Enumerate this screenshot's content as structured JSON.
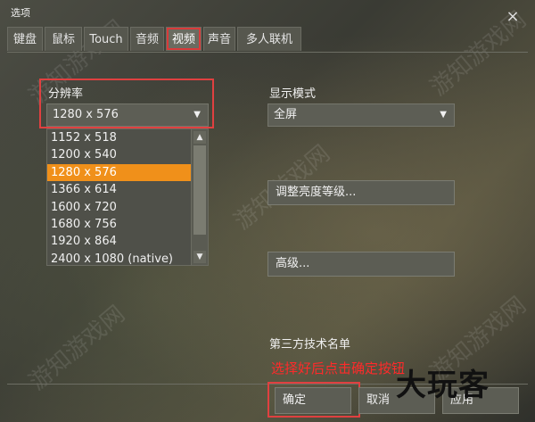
{
  "window": {
    "title": "选项",
    "close_icon": "×"
  },
  "tabs": [
    {
      "label": "键盘",
      "active": false
    },
    {
      "label": "鼠标",
      "active": false
    },
    {
      "label": "Touch",
      "active": false
    },
    {
      "label": "音频",
      "active": false
    },
    {
      "label": "视频",
      "active": true
    },
    {
      "label": "声音",
      "active": false
    },
    {
      "label": "多人联机",
      "active": false
    }
  ],
  "resolution": {
    "label": "分辨率",
    "selected": "1280 x 576",
    "options": [
      "1152 x 518",
      "1200 x 540",
      "1280 x 576",
      "1366 x 614",
      "1600 x 720",
      "1680 x 756",
      "1920 x 864",
      "2400 x 1080 (native)"
    ],
    "selected_index": 2
  },
  "display_mode": {
    "label": "显示模式",
    "selected": "全屏"
  },
  "buttons": {
    "brightness": "调整亮度等级...",
    "advanced": "高级...",
    "ok": "确定",
    "cancel": "取消",
    "apply": "应用"
  },
  "third_party_label": "第三方技术名单",
  "hint_text": "选择好后点击确定按钮",
  "brand_text": "大玩客",
  "watermark_text": "游知游戏网",
  "colors": {
    "highlight": "#f0901a",
    "annotation_red": "#e04040"
  }
}
